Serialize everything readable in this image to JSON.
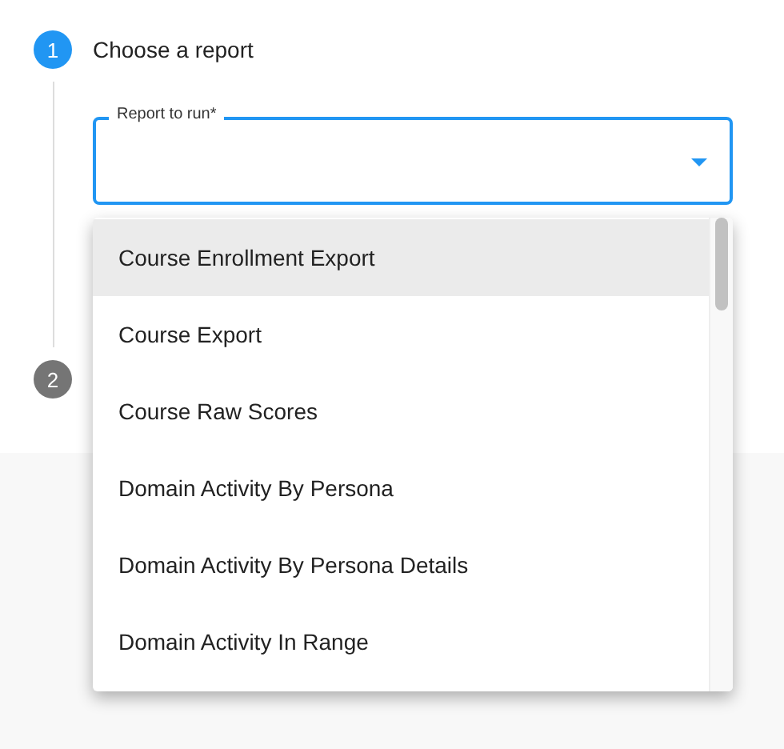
{
  "steps": [
    {
      "number": "1",
      "title": "Choose a report",
      "active": true
    },
    {
      "number": "2",
      "active": false
    }
  ],
  "field": {
    "label": "Report to run*",
    "focused": true
  },
  "menu": {
    "items": [
      {
        "label": "Course Enrollment Export",
        "selected": true
      },
      {
        "label": "Course Export",
        "selected": false
      },
      {
        "label": "Course Raw Scores",
        "selected": false
      },
      {
        "label": "Domain Activity By Persona",
        "selected": false
      },
      {
        "label": "Domain Activity By Persona Details",
        "selected": false
      },
      {
        "label": "Domain Activity In Range",
        "selected": false
      }
    ]
  }
}
